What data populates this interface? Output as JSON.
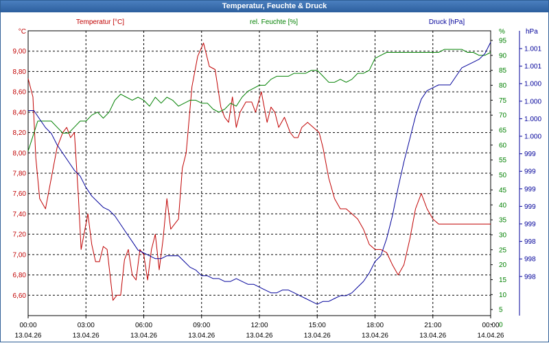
{
  "window": {
    "title": "Temperatur, Feuchte & Druck"
  },
  "colors": {
    "temperature": "#c00000",
    "humidity": "#008000",
    "pressure": "#00009a",
    "grid": "#000000",
    "title_bar": "#2d5f9e"
  },
  "chart_data": {
    "type": "line",
    "title": "Temperatur, Feuchte & Druck",
    "grid": true,
    "x": {
      "range_hours": [
        0,
        24
      ],
      "tick_times": [
        "00:00",
        "03:00",
        "06:00",
        "09:00",
        "12:00",
        "15:00",
        "18:00",
        "21:00",
        "00:00"
      ],
      "tick_dates": [
        "13.04.26",
        "13.04.26",
        "13.04.26",
        "13.04.26",
        "13.04.26",
        "13.04.26",
        "13.04.26",
        "13.04.26",
        "14.04.26"
      ]
    },
    "axes": {
      "temperature": {
        "label": "Temperatur [°C]",
        "unit": "°C",
        "range": [
          6.4,
          9.2
        ],
        "ticks": [
          "9,00",
          "8,80",
          "8,60",
          "8,40",
          "8,20",
          "8,00",
          "7,80",
          "7,60",
          "7,40",
          "7,20",
          "7,00",
          "6,80",
          "6,60"
        ]
      },
      "humidity": {
        "label": "rel. Feuchte [%]",
        "unit": "%",
        "range": [
          0,
          95
        ],
        "ticks": [
          "95",
          "90",
          "85",
          "80",
          "75",
          "70",
          "65",
          "60",
          "55",
          "50",
          "45",
          "40",
          "35",
          "30",
          "25",
          "20",
          "15",
          "10",
          "5",
          "0"
        ]
      },
      "pressure": {
        "label": "Druck [hPa]",
        "unit": "hPa",
        "ticks": [
          "1.001",
          "1.001",
          "1.000",
          "1.000",
          "1.000",
          "1.000",
          "999",
          "999",
          "999",
          "999",
          "999",
          "998",
          "998",
          "998"
        ]
      }
    },
    "series": [
      {
        "name": "Temperatur [°C]",
        "color": "#c00000",
        "axis": "temperature",
        "x": [
          0,
          0.25,
          0.4,
          0.6,
          0.9,
          1.2,
          1.5,
          1.8,
          2.0,
          2.2,
          2.4,
          2.6,
          2.75,
          2.9,
          3.1,
          3.3,
          3.5,
          3.7,
          3.9,
          4.1,
          4.4,
          4.6,
          4.8,
          5.0,
          5.2,
          5.4,
          5.6,
          5.8,
          6.0,
          6.2,
          6.4,
          6.6,
          6.8,
          7.0,
          7.2,
          7.4,
          7.6,
          7.8,
          8.0,
          8.2,
          8.5,
          8.8,
          9.1,
          9.4,
          9.7,
          10.0,
          10.2,
          10.4,
          10.6,
          10.8,
          11.0,
          11.3,
          11.6,
          11.8,
          12.1,
          12.4,
          12.6,
          12.8,
          13.0,
          13.3,
          13.6,
          13.8,
          14.0,
          14.2,
          14.5,
          14.8,
          15.1,
          15.3,
          15.6,
          15.9,
          16.2,
          16.5,
          16.8,
          17.1,
          17.4,
          17.7,
          18.0,
          18.3,
          18.6,
          18.9,
          19.2,
          19.5,
          19.8,
          20.1,
          20.4,
          20.7,
          21.0,
          21.3,
          21.6,
          21.9,
          22.2,
          22.4,
          22.7,
          23.0,
          23.3,
          23.6,
          23.8,
          24.0
        ],
        "values": [
          8.73,
          8.55,
          7.95,
          7.55,
          7.45,
          7.75,
          8.05,
          8.2,
          8.25,
          8.15,
          8.2,
          7.6,
          7.05,
          7.2,
          7.4,
          7.1,
          6.93,
          6.93,
          7.08,
          7.05,
          6.55,
          6.6,
          6.6,
          6.95,
          7.05,
          6.8,
          6.75,
          7.05,
          7.0,
          6.75,
          7.05,
          7.2,
          6.85,
          7.15,
          7.55,
          7.25,
          7.3,
          7.35,
          7.85,
          8.0,
          8.65,
          8.95,
          9.08,
          8.85,
          8.82,
          8.45,
          8.35,
          8.3,
          8.55,
          8.25,
          8.4,
          8.5,
          8.5,
          8.4,
          8.6,
          8.3,
          8.45,
          8.4,
          8.25,
          8.35,
          8.2,
          8.15,
          8.15,
          8.25,
          8.3,
          8.25,
          8.2,
          8.05,
          7.75,
          7.55,
          7.45,
          7.45,
          7.4,
          7.35,
          7.25,
          7.1,
          7.05,
          7.05,
          7.02,
          6.9,
          6.8,
          6.9,
          7.15,
          7.45,
          7.6,
          7.45,
          7.35,
          7.3,
          7.3,
          7.3,
          7.3,
          7.3,
          7.3,
          7.3,
          7.3,
          7.3,
          7.3,
          7.3
        ]
      },
      {
        "name": "rel. Feuchte [%]",
        "color": "#008000",
        "axis": "humidity",
        "x": [
          0,
          0.2,
          0.5,
          0.9,
          1.2,
          1.5,
          1.8,
          2.1,
          2.4,
          2.7,
          3.0,
          3.3,
          3.6,
          3.9,
          4.2,
          4.5,
          4.8,
          5.1,
          5.4,
          5.7,
          6.0,
          6.3,
          6.6,
          6.9,
          7.2,
          7.5,
          7.8,
          8.1,
          8.4,
          8.7,
          9.0,
          9.3,
          9.6,
          9.9,
          10.2,
          10.5,
          10.8,
          11.1,
          11.4,
          11.7,
          12.0,
          12.3,
          12.6,
          12.9,
          13.2,
          13.5,
          13.8,
          14.1,
          14.4,
          14.7,
          15.0,
          15.3,
          15.6,
          15.9,
          16.2,
          16.5,
          16.8,
          17.1,
          17.4,
          17.7,
          18.0,
          18.3,
          18.6,
          18.9,
          19.2,
          19.5,
          19.8,
          20.1,
          20.4,
          20.7,
          21.0,
          21.3,
          21.6,
          21.9,
          22.2,
          22.5,
          22.8,
          23.1,
          23.4,
          23.7,
          24.0
        ],
        "values": [
          58,
          62,
          68,
          68,
          68,
          66,
          64,
          64,
          66,
          68,
          68,
          70,
          71,
          69,
          71,
          75,
          77,
          76,
          75,
          76,
          75,
          73,
          76,
          74,
          76,
          75,
          73,
          74,
          75,
          75,
          74,
          74,
          72,
          71,
          72,
          74,
          73,
          76,
          78,
          79,
          80,
          80,
          82,
          83,
          83,
          83,
          84,
          84,
          84,
          85,
          85,
          83,
          81,
          81,
          82,
          81,
          82,
          84,
          84,
          85,
          89,
          90,
          91,
          91,
          91,
          91,
          91,
          91,
          91,
          91,
          91,
          91,
          92,
          92,
          92,
          92,
          91,
          91,
          90,
          90,
          91
        ]
      },
      {
        "name": "Druck [hPa]",
        "color": "#00009a",
        "axis": "pressure",
        "x": [
          0,
          0.3,
          0.6,
          0.9,
          1.2,
          1.5,
          1.8,
          2.1,
          2.4,
          2.7,
          3.0,
          3.3,
          3.6,
          3.9,
          4.2,
          4.5,
          4.8,
          5.1,
          5.4,
          5.7,
          6.0,
          6.3,
          6.6,
          6.9,
          7.2,
          7.5,
          7.8,
          8.1,
          8.4,
          8.7,
          9.0,
          9.3,
          9.6,
          9.9,
          10.2,
          10.5,
          10.8,
          11.1,
          11.4,
          11.7,
          12.0,
          12.3,
          12.6,
          12.9,
          13.2,
          13.5,
          13.8,
          14.1,
          14.4,
          14.7,
          15.0,
          15.3,
          15.6,
          15.9,
          16.2,
          16.5,
          16.8,
          17.1,
          17.4,
          17.7,
          18.0,
          18.3,
          18.6,
          18.9,
          19.2,
          19.5,
          19.8,
          20.1,
          20.4,
          20.7,
          21.0,
          21.3,
          21.6,
          21.9,
          22.2,
          22.5,
          22.8,
          23.1,
          23.4,
          23.7,
          24.0
        ],
        "values": [
          72,
          72,
          69,
          66,
          64,
          60,
          57,
          54,
          51,
          49,
          45,
          42,
          40,
          38,
          37,
          35,
          32,
          29,
          26,
          23,
          22,
          21,
          20,
          20,
          21,
          21,
          21,
          19,
          17,
          16,
          14,
          14,
          13,
          13,
          12,
          12,
          13,
          12,
          11,
          11,
          10,
          9,
          8,
          8,
          9,
          9,
          8,
          7,
          6,
          5,
          4,
          5,
          5,
          6,
          7,
          7,
          8,
          10,
          12,
          15,
          19,
          21,
          27,
          35,
          45,
          54,
          62,
          70,
          76,
          79,
          80,
          81,
          81,
          81,
          84,
          87,
          88,
          89,
          90,
          92,
          96
        ]
      }
    ]
  }
}
